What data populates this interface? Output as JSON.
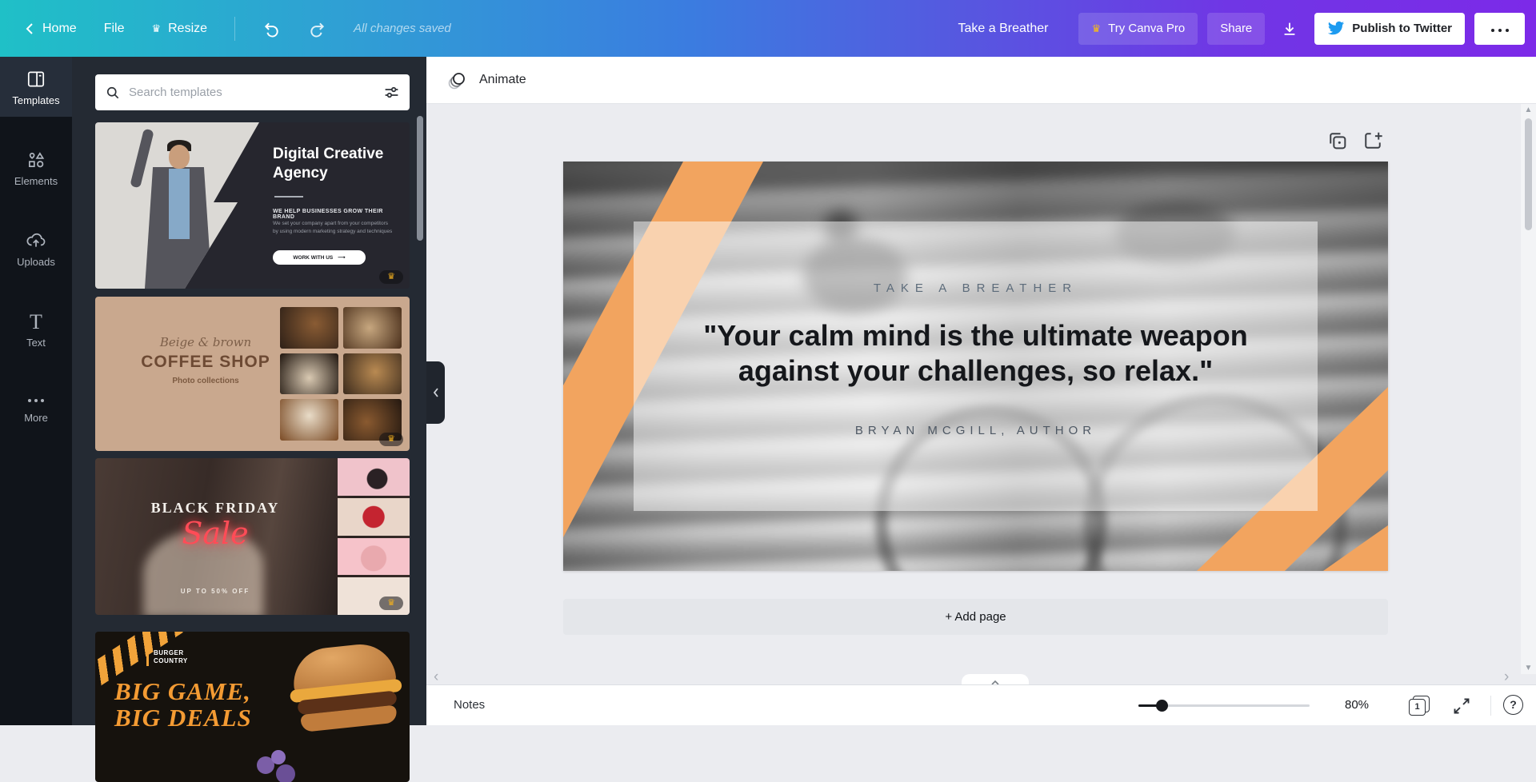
{
  "topbar": {
    "back_label": "Home",
    "file_label": "File",
    "resize_label": "Resize",
    "status": "All changes saved",
    "title": "Take a Breather",
    "try_pro_label": "Try Canva Pro",
    "share_label": "Share",
    "publish_label": "Publish to Twitter"
  },
  "sidebar": {
    "items": [
      {
        "label": "Templates"
      },
      {
        "label": "Elements"
      },
      {
        "label": "Uploads"
      },
      {
        "label": "Text"
      },
      {
        "label": "More"
      }
    ]
  },
  "panel": {
    "search_placeholder": "Search templates",
    "templates": [
      {
        "title": "Digital Creative Agency",
        "tagline": "WE HELP BUSINESSES GROW THEIR BRAND",
        "body": "We set your company apart from your competitors by using modern marketing strategy and techniques",
        "cta": "WORK WITH US"
      },
      {
        "script": "Beige & brown",
        "title": "COFFEE SHOP",
        "subtitle": "Photo collections"
      },
      {
        "title": "BLACK FRIDAY",
        "script": "Sale",
        "subtitle": "UP TO 50% OFF"
      },
      {
        "logo": "BURGER COUNTRY",
        "line1": "BIG GAME,",
        "line2": "BIG DEALS"
      }
    ]
  },
  "canvas": {
    "animate_label": "Animate",
    "page": {
      "eyebrow": "TAKE A BREATHER",
      "quote_line1": "\"Your calm mind is the ultimate weapon",
      "quote_line2": "against your challenges, so relax.\"",
      "author": "BRYAN MCGILL, AUTHOR"
    },
    "add_page_label": "+ Add page"
  },
  "bottombar": {
    "notes_label": "Notes",
    "zoom_value": "80%",
    "page_number": "1"
  },
  "colors": {
    "gradient_left": "#1FC0C7",
    "gradient_right": "#7C2AE8",
    "accent_orange": "#F2A45F",
    "twitter_blue": "#1D9BF0",
    "crown_gold": "#F2B01E"
  }
}
